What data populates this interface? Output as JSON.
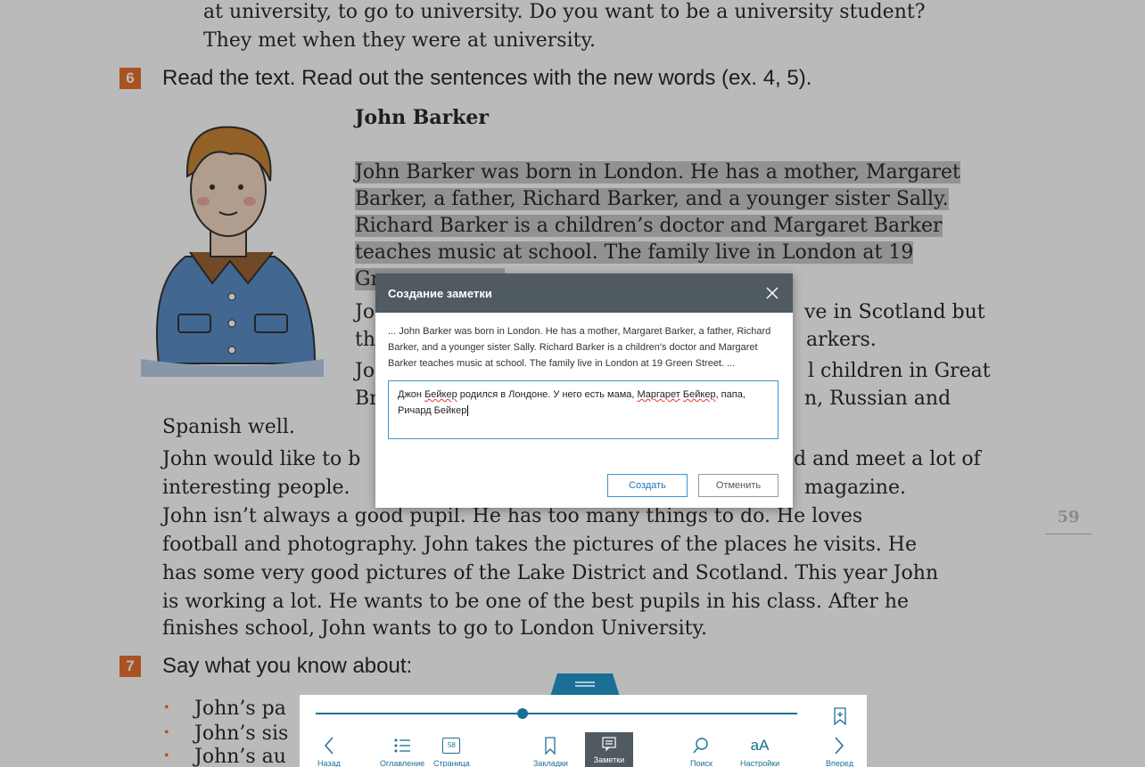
{
  "book": {
    "top_lines": [
      "at university, to go to university. Do you want to be a university student?",
      "They met when they were at university."
    ],
    "ex6": {
      "number": "6",
      "instruction": "Read the text. Read out the sentences with the new words (ex. 4, 5)."
    },
    "story_title": "John Barker",
    "highlighted_lines": [
      "John Barker was born in London. He has a mother, Margaret",
      "Barker, a father, Richard Barker, and a younger sister Sally.",
      "Richard Barker is a children’s doctor and Margaret Barker",
      "teaches music at school. The family live in London at 19"
    ],
    "hl_partial": "Gr",
    "right_fragments": [
      "ve in Scotland but",
      "arkers.",
      "l children in Great",
      "n, Russian and"
    ],
    "left_fragments": [
      "Jo",
      "th",
      "Jo",
      "Br"
    ],
    "body_lines": [
      "Spanish well.",
      "John would like to b",
      "interesting people.",
      "John isn’t always a good pupil. He has too many things to do. He loves",
      "football and photography. John takes the pictures of the places he visits. He",
      "has some very good pictures of the Lake District and Scotland. This year John",
      "is working a lot. He wants to be one of the best pupils in his class. After he",
      "finishes school, John wants to go to London University."
    ],
    "body_right": [
      "d and meet a lot of",
      "magazine."
    ],
    "ex7": {
      "number": "7",
      "instruction": "Say what you know about:"
    },
    "bullets": [
      "John’s pa",
      "John’s sis",
      "John’s au"
    ],
    "page_number": "59"
  },
  "modal": {
    "title": "Создание заметки",
    "quote": "... John Barker was born in London. He has a mother, Margaret Barker, a father, Richard Barker, and a younger sister Sally. Richard Barker is a children's doctor and Margaret Barker teaches music at school. The family live in London at 19 Green Street. ...",
    "note_parts": {
      "p1": "Джон ",
      "p2": "Бейкер",
      "p3": " родился в Лондоне. У него есть мама, ",
      "p4": "Маргарет",
      "p5": " ",
      "p6": "Бейкер",
      "p7": ", папа,\nРичард Бейкер"
    },
    "create_label": "Создать",
    "cancel_label": "Отменить"
  },
  "toolbar": {
    "progress": 0.43,
    "items": {
      "back": "Назад",
      "contents": "Оглавление",
      "page": "Страница",
      "page_badge": "58",
      "bookmarks": "Закладки",
      "notes": "Заметки",
      "search": "Поиск",
      "settings": "Настройки",
      "settings_glyph": "aA",
      "forward": "Вперед"
    }
  },
  "colors": {
    "accent": "#1a6f96",
    "exercise_badge": "#e8722c",
    "modal_header": "#4f5a61",
    "highlight": "#c8c8c8"
  }
}
